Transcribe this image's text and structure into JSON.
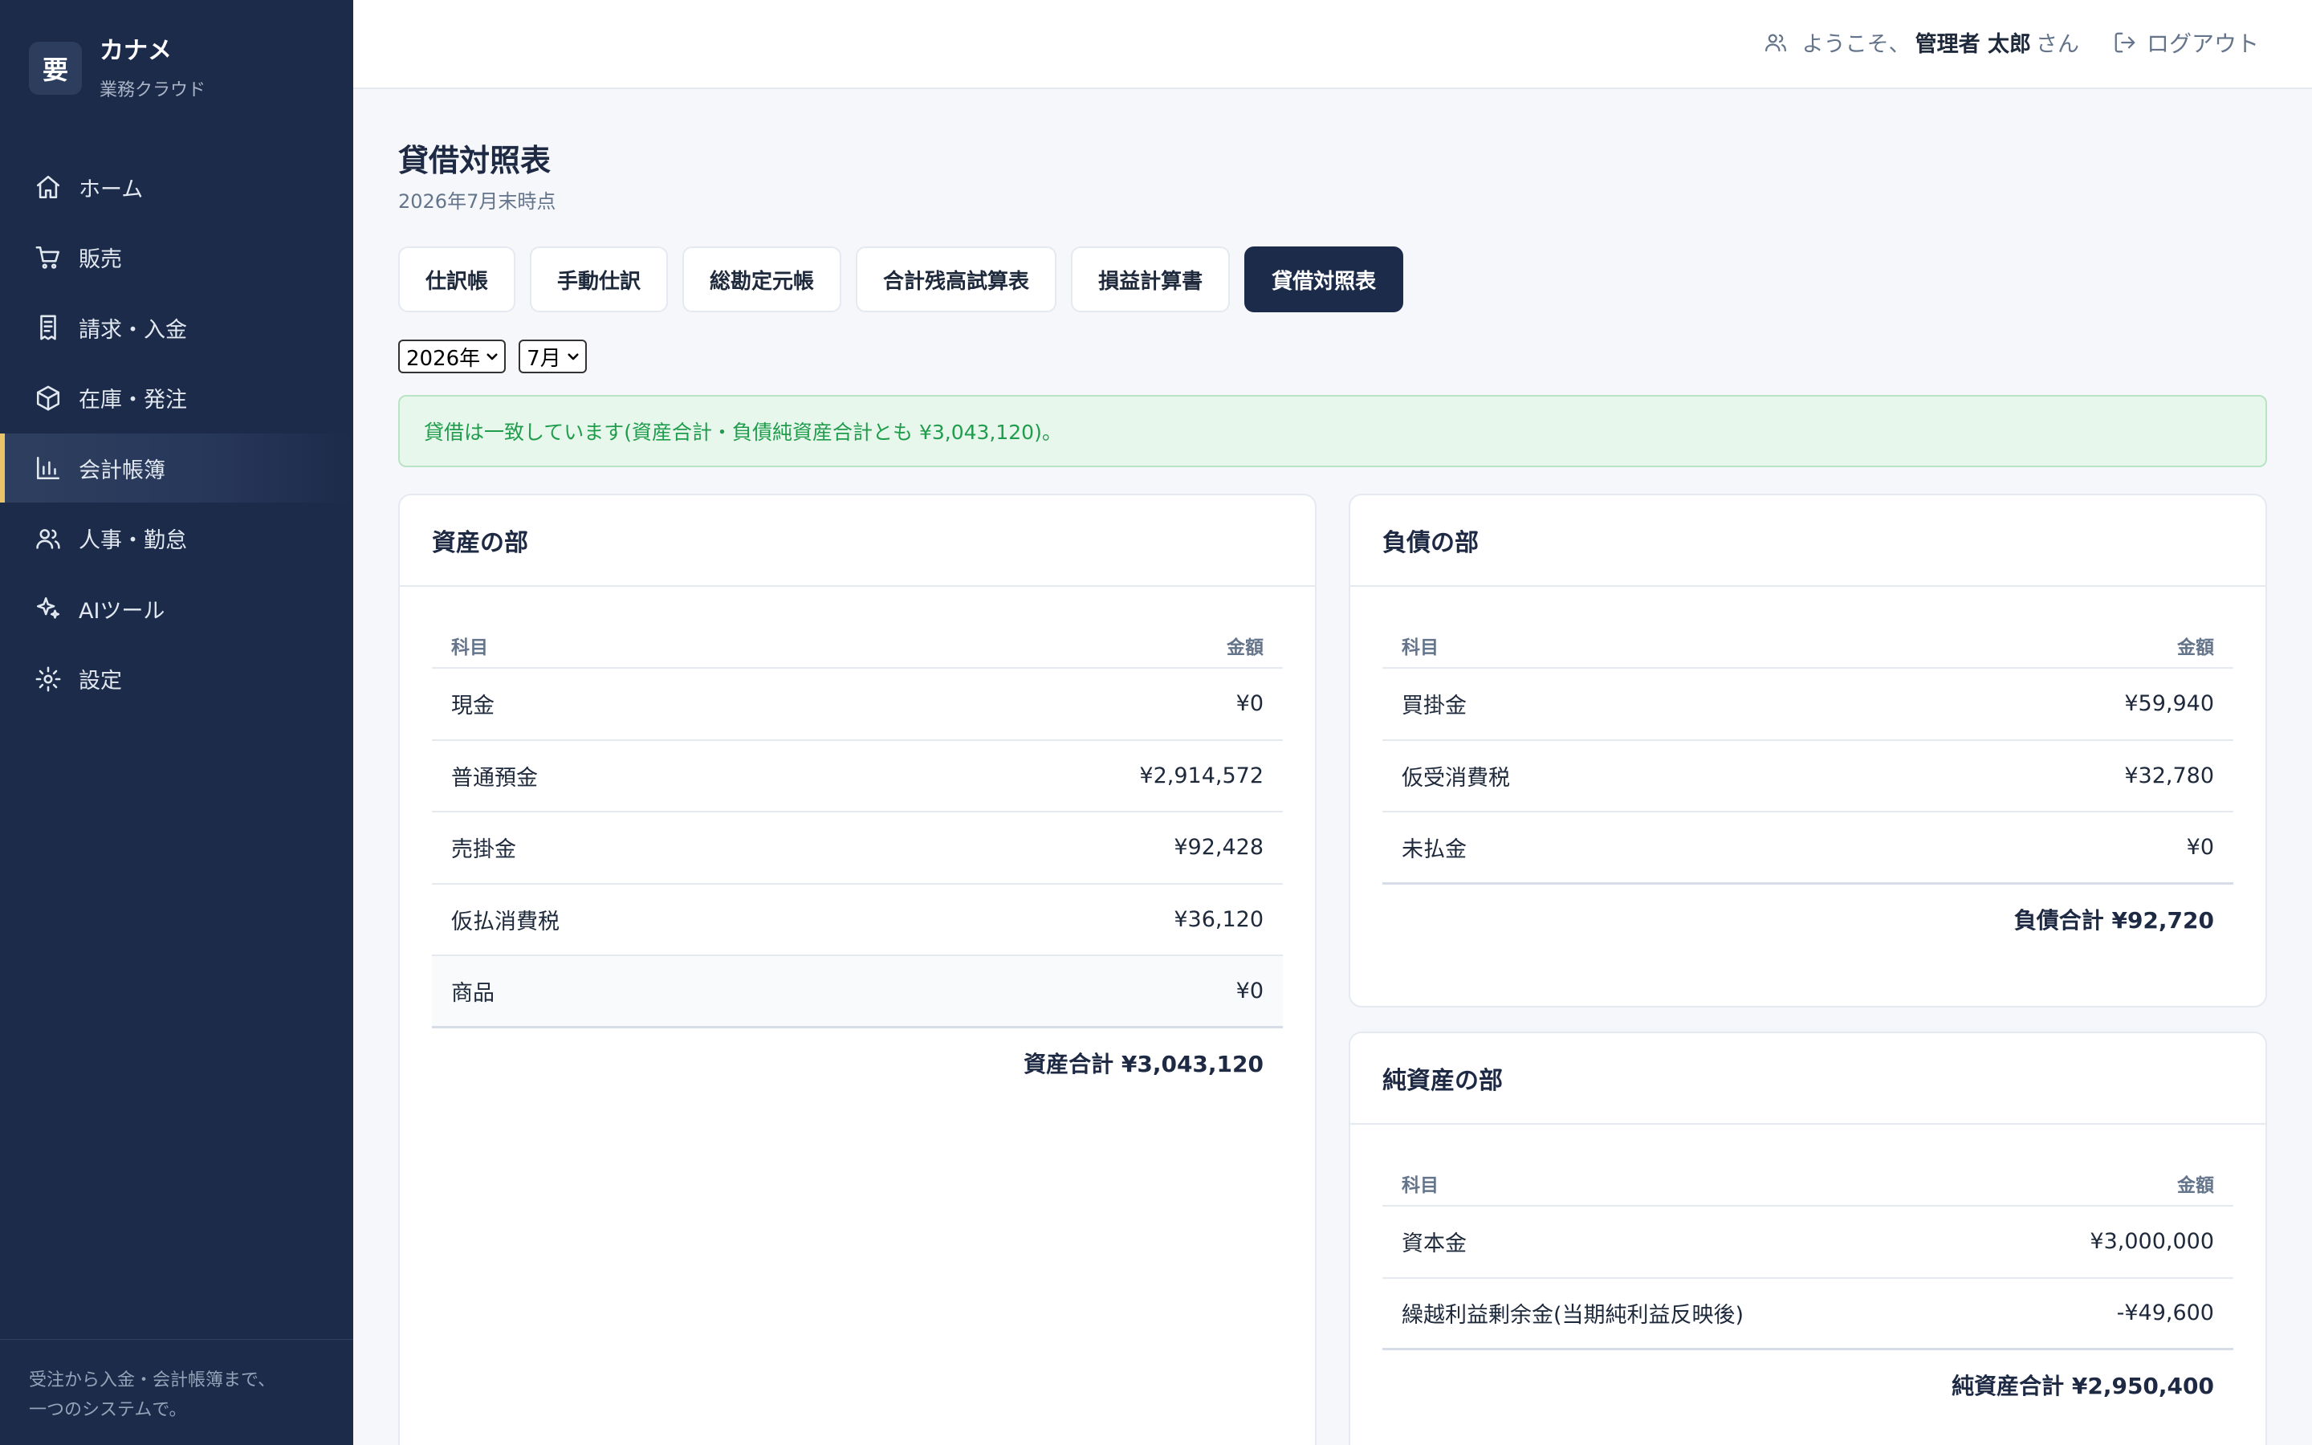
{
  "brand": {
    "logo_char": "要",
    "name": "カナメ",
    "subtitle": "業務クラウド"
  },
  "sidebar": {
    "items": [
      {
        "label": "ホーム",
        "icon": "home-icon"
      },
      {
        "label": "販売",
        "icon": "cart-icon"
      },
      {
        "label": "請求・入金",
        "icon": "receipt-icon"
      },
      {
        "label": "在庫・発注",
        "icon": "box-icon"
      },
      {
        "label": "会計帳簿",
        "icon": "bar-chart-icon",
        "active": true
      },
      {
        "label": "人事・勤怠",
        "icon": "users-icon"
      },
      {
        "label": "AIツール",
        "icon": "sparkles-icon"
      },
      {
        "label": "設定",
        "icon": "gear-icon"
      }
    ],
    "footer_line1": "受注から入金・会計帳簿まで、",
    "footer_line2": "一つのシステムで。"
  },
  "header": {
    "welcome_prefix": "ようこそ、",
    "user_name": "管理者 太郎",
    "welcome_suffix": "さん",
    "logout_label": "ログアウト"
  },
  "page": {
    "title": "貸借対照表",
    "subtitle": "2026年7月末時点"
  },
  "tabs": [
    {
      "label": "仕訳帳"
    },
    {
      "label": "手動仕訳"
    },
    {
      "label": "総勘定元帳"
    },
    {
      "label": "合計残高試算表"
    },
    {
      "label": "損益計算書"
    },
    {
      "label": "貸借対照表",
      "active": true
    }
  ],
  "filters": {
    "year": "2026年",
    "month": "7月"
  },
  "alert": {
    "message": "貸借は一致しています(資産合計・負債純資産合計とも ¥3,043,120)。"
  },
  "colors": {
    "sidebar_bg": "#1c2b4a",
    "accent": "#e9c46a",
    "success": "#1f9d4c"
  },
  "assets": {
    "title": "資産の部",
    "col_account": "科目",
    "col_amount": "金額",
    "rows": [
      {
        "account": "現金",
        "amount": "¥0"
      },
      {
        "account": "普通預金",
        "amount": "¥2,914,572"
      },
      {
        "account": "売掛金",
        "amount": "¥92,428"
      },
      {
        "account": "仮払消費税",
        "amount": "¥36,120"
      },
      {
        "account": "商品",
        "amount": "¥0"
      }
    ],
    "total": "資産合計 ¥3,043,120"
  },
  "liabilities": {
    "title": "負債の部",
    "col_account": "科目",
    "col_amount": "金額",
    "rows": [
      {
        "account": "買掛金",
        "amount": "¥59,940"
      },
      {
        "account": "仮受消費税",
        "amount": "¥32,780"
      },
      {
        "account": "未払金",
        "amount": "¥0"
      }
    ],
    "total": "負債合計 ¥92,720"
  },
  "equity": {
    "title": "純資産の部",
    "col_account": "科目",
    "col_amount": "金額",
    "rows": [
      {
        "account": "資本金",
        "amount": "¥3,000,000"
      },
      {
        "account": "繰越利益剰余金(当期純利益反映後)",
        "amount": "-¥49,600"
      }
    ],
    "total": "純資産合計 ¥2,950,400"
  }
}
